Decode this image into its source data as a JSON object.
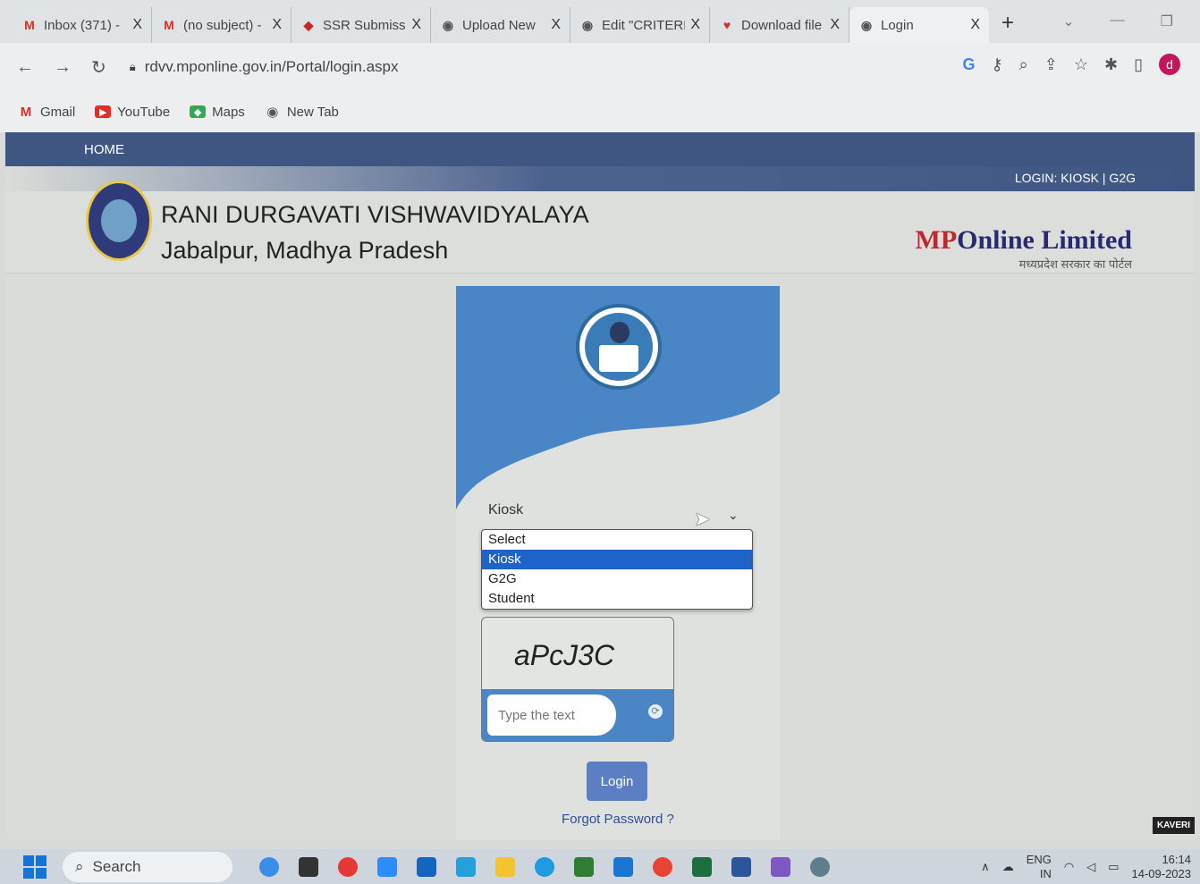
{
  "browser": {
    "tabs": [
      {
        "label": "Inbox (371) -",
        "icon": "gmail-icon"
      },
      {
        "label": "(no subject) -",
        "icon": "gmail-icon"
      },
      {
        "label": "SSR Submissi",
        "icon": "ssr-icon"
      },
      {
        "label": "Upload New",
        "icon": "globe-icon"
      },
      {
        "label": "Edit \"CRITERI/",
        "icon": "globe-icon"
      },
      {
        "label": "Download file",
        "icon": "heart-icon"
      },
      {
        "label": "Login",
        "icon": "globe-icon"
      }
    ],
    "tab_close": "X",
    "new_tab": "+",
    "url": "rdvv.mponline.gov.in/Portal/login.aspx",
    "bookmarks": [
      {
        "label": "Gmail"
      },
      {
        "label": "YouTube"
      },
      {
        "label": "Maps"
      },
      {
        "label": "New Tab"
      }
    ],
    "profile_initial": "d",
    "ext_g": "G"
  },
  "page": {
    "nav_home": "HOME",
    "login_links": "LOGIN: KIOSK | G2G",
    "univ_line1": "RANI DURGAVATI VISHWAVIDYALAYA",
    "univ_line2": "Jabalpur, Madhya Pradesh",
    "brand_mp": "MP",
    "brand_rest": "Online Limited",
    "brand_tag": "मध्यप्रदेश सरकार का पोर्टल",
    "select_value": "Kiosk",
    "options": [
      "Select",
      "Kiosk",
      "G2G",
      "Student"
    ],
    "captcha_code": "aPcJ3C",
    "captcha_placeholder": "Type the text",
    "login_label": "Login",
    "forgot_label": "Forgot Password ?",
    "kaveri": "KAVERI"
  },
  "taskbar": {
    "search_label": "Search",
    "lang": "ENG",
    "region": "IN",
    "time": "16:14",
    "date": "14-09-2023"
  }
}
